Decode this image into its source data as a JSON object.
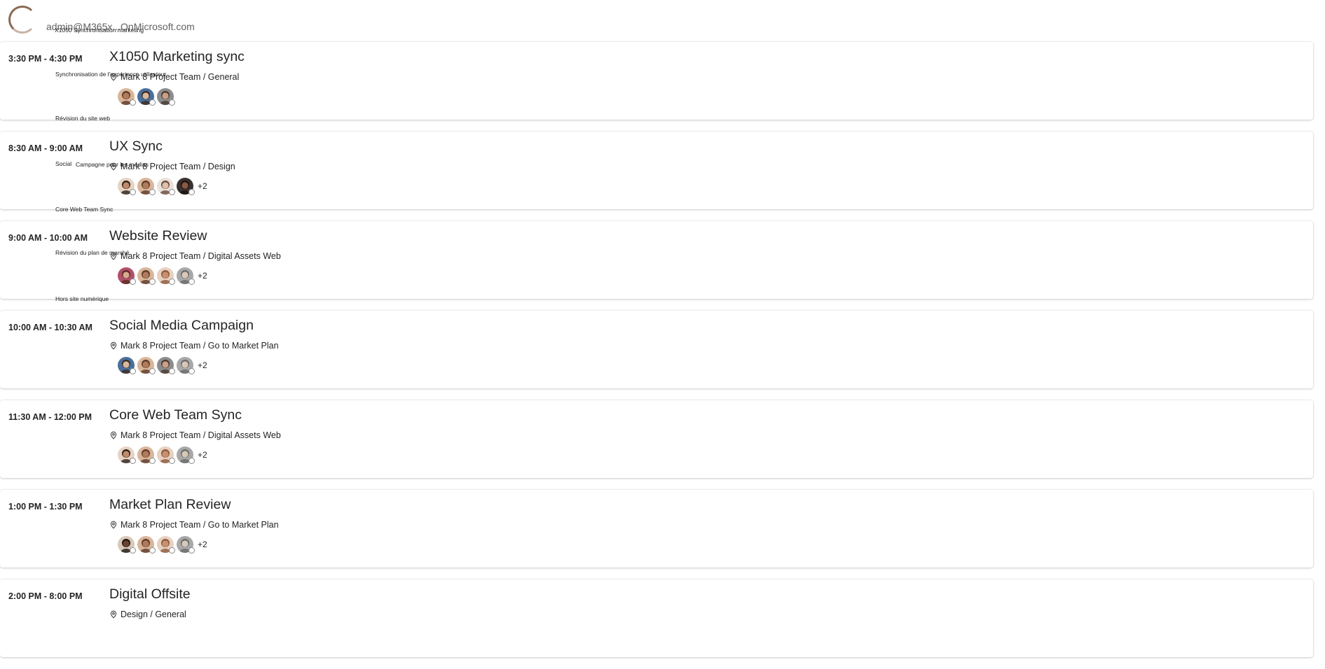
{
  "header": {
    "email": "admin@M365x...OnMicrosoft.com"
  },
  "overlay_labels": [
    "X1050 Synchronisation marketing",
    "Synchronisation de l'expérience utilisateur",
    "Révision du site web",
    "Social",
    "Campagne pour les médias",
    "Core Web Team Sync",
    "Révision du plan de marché",
    "Hors site numérique"
  ],
  "events": [
    {
      "time": "3:30 PM - 4:30 PM",
      "title": "X1050 Marketing sync",
      "location": "Mark 8 Project Team / General",
      "attendees": [
        {
          "skin": "#b07a5c",
          "hair": "#5a3a28",
          "bg": "#d9b59a"
        },
        {
          "skin": "#d8b8a0",
          "hair": "#3b2b22",
          "bg": "#4a6f9a"
        },
        {
          "skin": "#c9a088",
          "hair": "#4a3a30",
          "bg": "#8c8c8c"
        }
      ],
      "more": ""
    },
    {
      "time": "8:30 AM - 9:00 AM",
      "title": "UX Sync",
      "location": "Mark 8 Project Team / Design",
      "attendees": [
        {
          "skin": "#c08a6a",
          "hair": "#2a1f1a",
          "bg": "#e7d3c4"
        },
        {
          "skin": "#b07a5c",
          "hair": "#5a3a28",
          "bg": "#d9b59a"
        },
        {
          "skin": "#e0c0a8",
          "hair": "#6a4a38",
          "bg": "#e9e2dc"
        },
        {
          "skin": "#8a5a40",
          "hair": "#1c1410",
          "bg": "#3a3030"
        }
      ],
      "more": "+2"
    },
    {
      "time": "9:00 AM - 10:00 AM",
      "title": "Website Review",
      "location": "Mark 8 Project Team / Digital Assets Web",
      "attendees": [
        {
          "skin": "#d8a890",
          "hair": "#5a2a20",
          "bg": "#b0506a"
        },
        {
          "skin": "#b07a5c",
          "hair": "#5a3a28",
          "bg": "#d9b59a"
        },
        {
          "skin": "#c89070",
          "hair": "#8a5a3a",
          "bg": "#e8d0c0"
        },
        {
          "skin": "#d8c8b8",
          "hair": "#6a6a6a",
          "bg": "#a8a8a8"
        }
      ],
      "more": "+2"
    },
    {
      "time": "10:00 AM - 10:30 AM",
      "title": "Social Media Campaign",
      "location": "Mark 8 Project Team / Go to Market Plan",
      "attendees": [
        {
          "skin": "#d8b8a0",
          "hair": "#3b2b22",
          "bg": "#4a6f9a"
        },
        {
          "skin": "#b07a5c",
          "hair": "#5a3a28",
          "bg": "#d9b59a"
        },
        {
          "skin": "#c9a088",
          "hair": "#4a3a30",
          "bg": "#8c8c8c"
        },
        {
          "skin": "#d8c8b8",
          "hair": "#6a6a6a",
          "bg": "#a8a8a8"
        }
      ],
      "more": "+2"
    },
    {
      "time": "11:30 AM - 12:00 PM",
      "title": "Core Web Team Sync",
      "location": "Mark 8 Project Team / Digital Assets Web",
      "attendees": [
        {
          "skin": "#c08a6a",
          "hair": "#2a1f1a",
          "bg": "#e7d3c4"
        },
        {
          "skin": "#b07a5c",
          "hair": "#5a3a28",
          "bg": "#d9b59a"
        },
        {
          "skin": "#c89070",
          "hair": "#8a5a3a",
          "bg": "#e8d0c0"
        },
        {
          "skin": "#d8c8b8",
          "hair": "#6a6a6a",
          "bg": "#a8a8a8"
        }
      ],
      "more": "+2"
    },
    {
      "time": "1:00 PM - 1:30 PM",
      "title": "Market Plan Review",
      "location": "Mark 8 Project Team / Go to Market Plan",
      "attendees": [
        {
          "skin": "#6a4030",
          "hair": "#1a1410",
          "bg": "#d8c8b8"
        },
        {
          "skin": "#b07a5c",
          "hair": "#5a3a28",
          "bg": "#d9b59a"
        },
        {
          "skin": "#c89070",
          "hair": "#8a5a3a",
          "bg": "#e8d0c0"
        },
        {
          "skin": "#d8c8b8",
          "hair": "#6a6a6a",
          "bg": "#a8a8a8"
        }
      ],
      "more": "+2"
    },
    {
      "time": "2:00 PM - 8:00 PM",
      "title": "Digital Offsite",
      "location": "Design / General",
      "attendees": [],
      "more": ""
    }
  ]
}
